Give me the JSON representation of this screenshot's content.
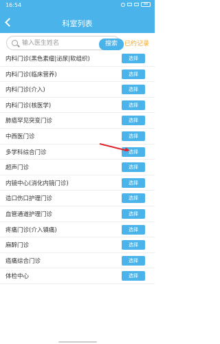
{
  "status_bar": {
    "time": "16:54",
    "battery": "88"
  },
  "header": {
    "title": "科室列表"
  },
  "search": {
    "placeholder": "输入医生姓名",
    "button_label": "搜索",
    "history_label": "已约记录"
  },
  "list": {
    "select_label": "选择",
    "items": [
      {
        "label": "内科门诊(黑色素瘤|泌尿|软组织)"
      },
      {
        "label": "内科门诊(临床营养)"
      },
      {
        "label": "内科门诊(介入)"
      },
      {
        "label": "内科门诊(核医学)"
      },
      {
        "label": "肺癌罕见突变门诊"
      },
      {
        "label": "中西医门诊"
      },
      {
        "label": "多学科综合门诊"
      },
      {
        "label": "超声门诊"
      },
      {
        "label": "内镜中心(消化内镜门诊)"
      },
      {
        "label": "造口伤口护理门诊"
      },
      {
        "label": "血管通道护理门诊"
      },
      {
        "label": "疼痛门诊(介入镇痛)"
      },
      {
        "label": "麻醉门诊"
      },
      {
        "label": "癌痛综合门诊"
      },
      {
        "label": "体检中心"
      }
    ]
  },
  "colors": {
    "accent": "#4ab3ea",
    "history": "#f5a623",
    "arrow": "#e0262b"
  }
}
